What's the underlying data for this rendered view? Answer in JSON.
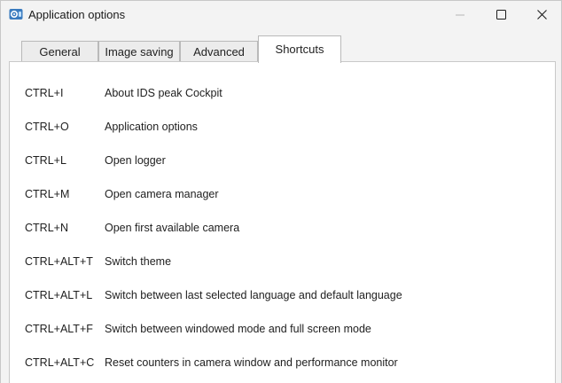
{
  "window": {
    "title": "Application options",
    "minimize_icon": "minimize-icon",
    "maximize_icon": "maximize-icon",
    "close_icon": "close-icon"
  },
  "tabs": [
    {
      "label": "General",
      "active": false
    },
    {
      "label": "Image saving",
      "active": false
    },
    {
      "label": "Advanced",
      "active": false
    },
    {
      "label": "Shortcuts",
      "active": true
    }
  ],
  "shortcuts": [
    {
      "key": "CTRL+I",
      "action": "About IDS peak Cockpit"
    },
    {
      "key": "CTRL+O",
      "action": "Application options"
    },
    {
      "key": "CTRL+L",
      "action": "Open logger"
    },
    {
      "key": "CTRL+M",
      "action": "Open camera manager"
    },
    {
      "key": "CTRL+N",
      "action": "Open first available camera"
    },
    {
      "key": "CTRL+ALT+T",
      "action": "Switch theme"
    },
    {
      "key": "CTRL+ALT+L",
      "action": "Switch between last selected language and default language"
    },
    {
      "key": "CTRL+ALT+F",
      "action": "Switch between windowed mode and full screen mode"
    },
    {
      "key": "CTRL+ALT+C",
      "action": "Reset counters in camera window and performance monitor"
    }
  ],
  "colors": {
    "titlebar": "#f3f3f3",
    "panel": "#ffffff",
    "border": "#c9c9c9",
    "app_icon": "#3a7bbf"
  }
}
